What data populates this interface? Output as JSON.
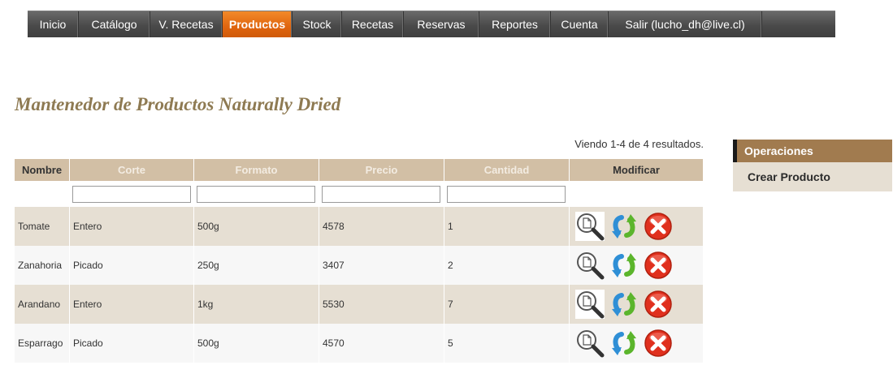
{
  "nav": {
    "items": [
      {
        "label": "Inicio",
        "active": false
      },
      {
        "label": "Catálogo",
        "active": false
      },
      {
        "label": "V. Recetas",
        "active": false
      },
      {
        "label": "Productos",
        "active": true
      },
      {
        "label": "Stock",
        "active": false
      },
      {
        "label": "Recetas",
        "active": false
      },
      {
        "label": "Reservas",
        "active": false
      },
      {
        "label": "Reportes",
        "active": false
      },
      {
        "label": "Cuenta",
        "active": false
      },
      {
        "label": "Salir (lucho_dh@live.cl)",
        "active": false
      }
    ]
  },
  "page": {
    "title": "Mantenedor de Productos Naturally Dried",
    "summary": "Viendo 1-4 de 4 resultados."
  },
  "table": {
    "headers": [
      "Nombre",
      "Corte",
      "Formato",
      "Precio",
      "Cantidad",
      "Modificar"
    ],
    "filters": [
      "",
      "",
      "",
      ""
    ],
    "rows": [
      {
        "nombre": "Tomate",
        "corte": "Entero",
        "formato": "500g",
        "precio": "4578",
        "cantidad": "1"
      },
      {
        "nombre": "Zanahoria",
        "corte": "Picado",
        "formato": "250g",
        "precio": "3407",
        "cantidad": "2"
      },
      {
        "nombre": "Arandano",
        "corte": "Entero",
        "formato": "1kg",
        "precio": "5530",
        "cantidad": "7"
      },
      {
        "nombre": "Esparrago",
        "corte": "Picado",
        "formato": "500g",
        "precio": "4570",
        "cantidad": "5"
      }
    ],
    "row_actions": [
      "view-icon",
      "update-icon",
      "delete-icon"
    ]
  },
  "sidebar": {
    "heading": "Operaciones",
    "items": [
      "Crear Producto"
    ]
  },
  "colors": {
    "accent": "#e0650f",
    "header_brown": "#d2bfa5",
    "sidebar_brown": "#a17b4f",
    "title_brown": "#8e7a52",
    "delete_red": "#e0301e",
    "update_blue": "#2f8fd6",
    "update_green": "#5bb52c"
  }
}
